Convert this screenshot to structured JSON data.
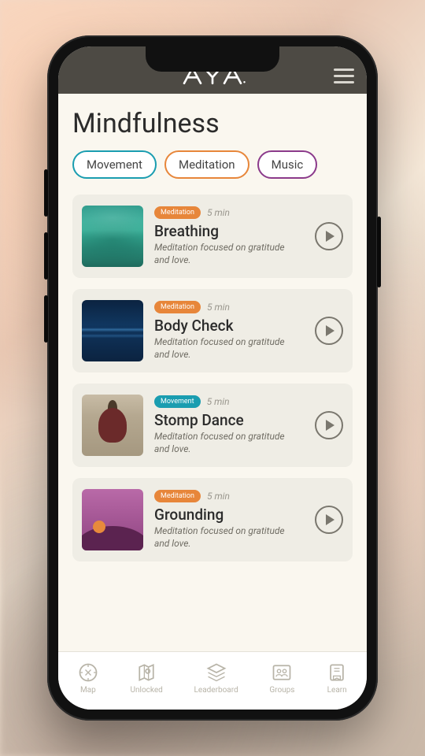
{
  "header": {
    "brand": "AYA"
  },
  "page": {
    "title": "Mindfulness"
  },
  "filters": [
    {
      "label": "Movement",
      "key": "movement"
    },
    {
      "label": "Meditation",
      "key": "meditation"
    },
    {
      "label": "Music",
      "key": "music"
    }
  ],
  "cards": [
    {
      "badge": "Meditation",
      "badge_type": "meditation",
      "duration": "5 min",
      "title": "Breathing",
      "desc": "Meditation focused on gratitude and love.",
      "thumb": "green"
    },
    {
      "badge": "Meditation",
      "badge_type": "meditation",
      "duration": "5 min",
      "title": "Body Check",
      "desc": "Meditation focused on gratitude and love.",
      "thumb": "blue"
    },
    {
      "badge": "Movement",
      "badge_type": "movement",
      "duration": "5 min",
      "title": "Stomp Dance",
      "desc": "Meditation focused on gratitude and love.",
      "thumb": "photo"
    },
    {
      "badge": "Meditation",
      "badge_type": "meditation",
      "duration": "5 min",
      "title": "Grounding",
      "desc": "Meditation focused on gratitude and love.",
      "thumb": "purple"
    }
  ],
  "nav": [
    {
      "label": "Map",
      "icon": "compass"
    },
    {
      "label": "Unlocked",
      "icon": "map-pin-card"
    },
    {
      "label": "Leaderboard",
      "icon": "stack"
    },
    {
      "label": "Groups",
      "icon": "people"
    },
    {
      "label": "Learn",
      "icon": "book"
    }
  ]
}
